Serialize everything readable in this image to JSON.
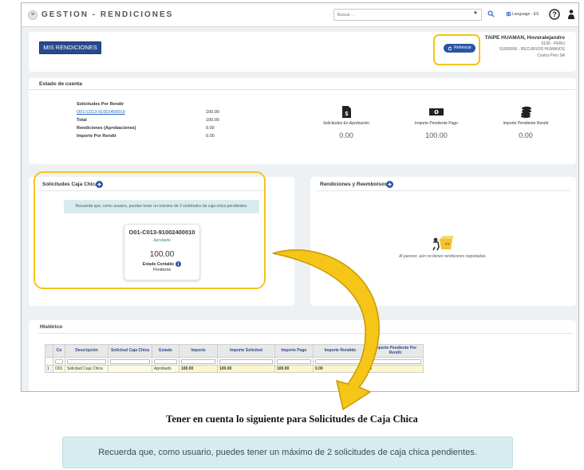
{
  "app": {
    "title": "GESTION - RENDICIONES",
    "search_placeholder": "Buscar ...",
    "language": "Language - ES"
  },
  "header": {
    "main_button": "MIS RENDICIONES",
    "refresh_button": "Refrescar",
    "user": {
      "name": "TAIPE HUAMAN, Hoveralejandro",
      "line2": "9100 - PERU",
      "line3": "91000006 - RECURSOS HUMANOS",
      "line4": "Costra Perú SA"
    }
  },
  "estado_cuenta": {
    "title": "Estado de cuenta",
    "rows": [
      {
        "label": "Solicitudes Por Rendir",
        "value": ""
      },
      {
        "label": "O01-C013-91002400010",
        "value": "100.00"
      },
      {
        "label": "Total",
        "value": "100.00"
      },
      {
        "label": "Rendiciones (Aprobaciones)",
        "value": "0.00"
      },
      {
        "label": "Importe Por Rendir",
        "value": "0.00"
      }
    ],
    "stats": [
      {
        "label": "Solicitudes En Aprobación",
        "value": "0.00",
        "icon": "document-dollar-icon"
      },
      {
        "label": "Importe Pendiente Pago",
        "value": "100.00",
        "icon": "banknote-icon"
      },
      {
        "label": "Importe Pendiente Rendir",
        "value": "0.00",
        "icon": "coins-icon"
      }
    ]
  },
  "solicitudes": {
    "title": "Solicitudes Caja Chica",
    "notice": "Recuerda que, como usuario, puedes tener un máximo de 2 solicitudes de caja chica pendientes.",
    "card": {
      "code": "O01-C013-91002400010",
      "status": "Aprobado",
      "amount": "100.00",
      "state_label": "Estado Contable",
      "state_value": "Pendiente"
    }
  },
  "rendiciones": {
    "title": "Rendiciones y Reembolsos",
    "empty_message": "Al parecer, aún no tienes rendiciones registradas."
  },
  "historico": {
    "title": "Histórico",
    "columns": [
      "Co",
      "Descripción",
      "Solicitud Caja Chica",
      "Estado",
      "Importe",
      "Importe Solicitud",
      "Importe Pago",
      "Importe Rendido",
      "Importe Pendiente Por Rendir"
    ],
    "rows": [
      [
        "1",
        "O01",
        "Solicitud Caja Chica",
        "",
        "Aprobado",
        "100.00",
        "100.00",
        "100.00",
        "0.00",
        "0"
      ]
    ]
  },
  "caption": "Tener en cuenta lo siguiente para Solicitudes de Caja Chica",
  "notice_enlarged": "Recuerda que, como usuario, puedes tener un máximo de 2 solicitudes de caja chica pendientes.",
  "colors": {
    "highlight": "#f5c518",
    "primary": "#274a8a",
    "notice_bg": "#d7ecf1"
  }
}
